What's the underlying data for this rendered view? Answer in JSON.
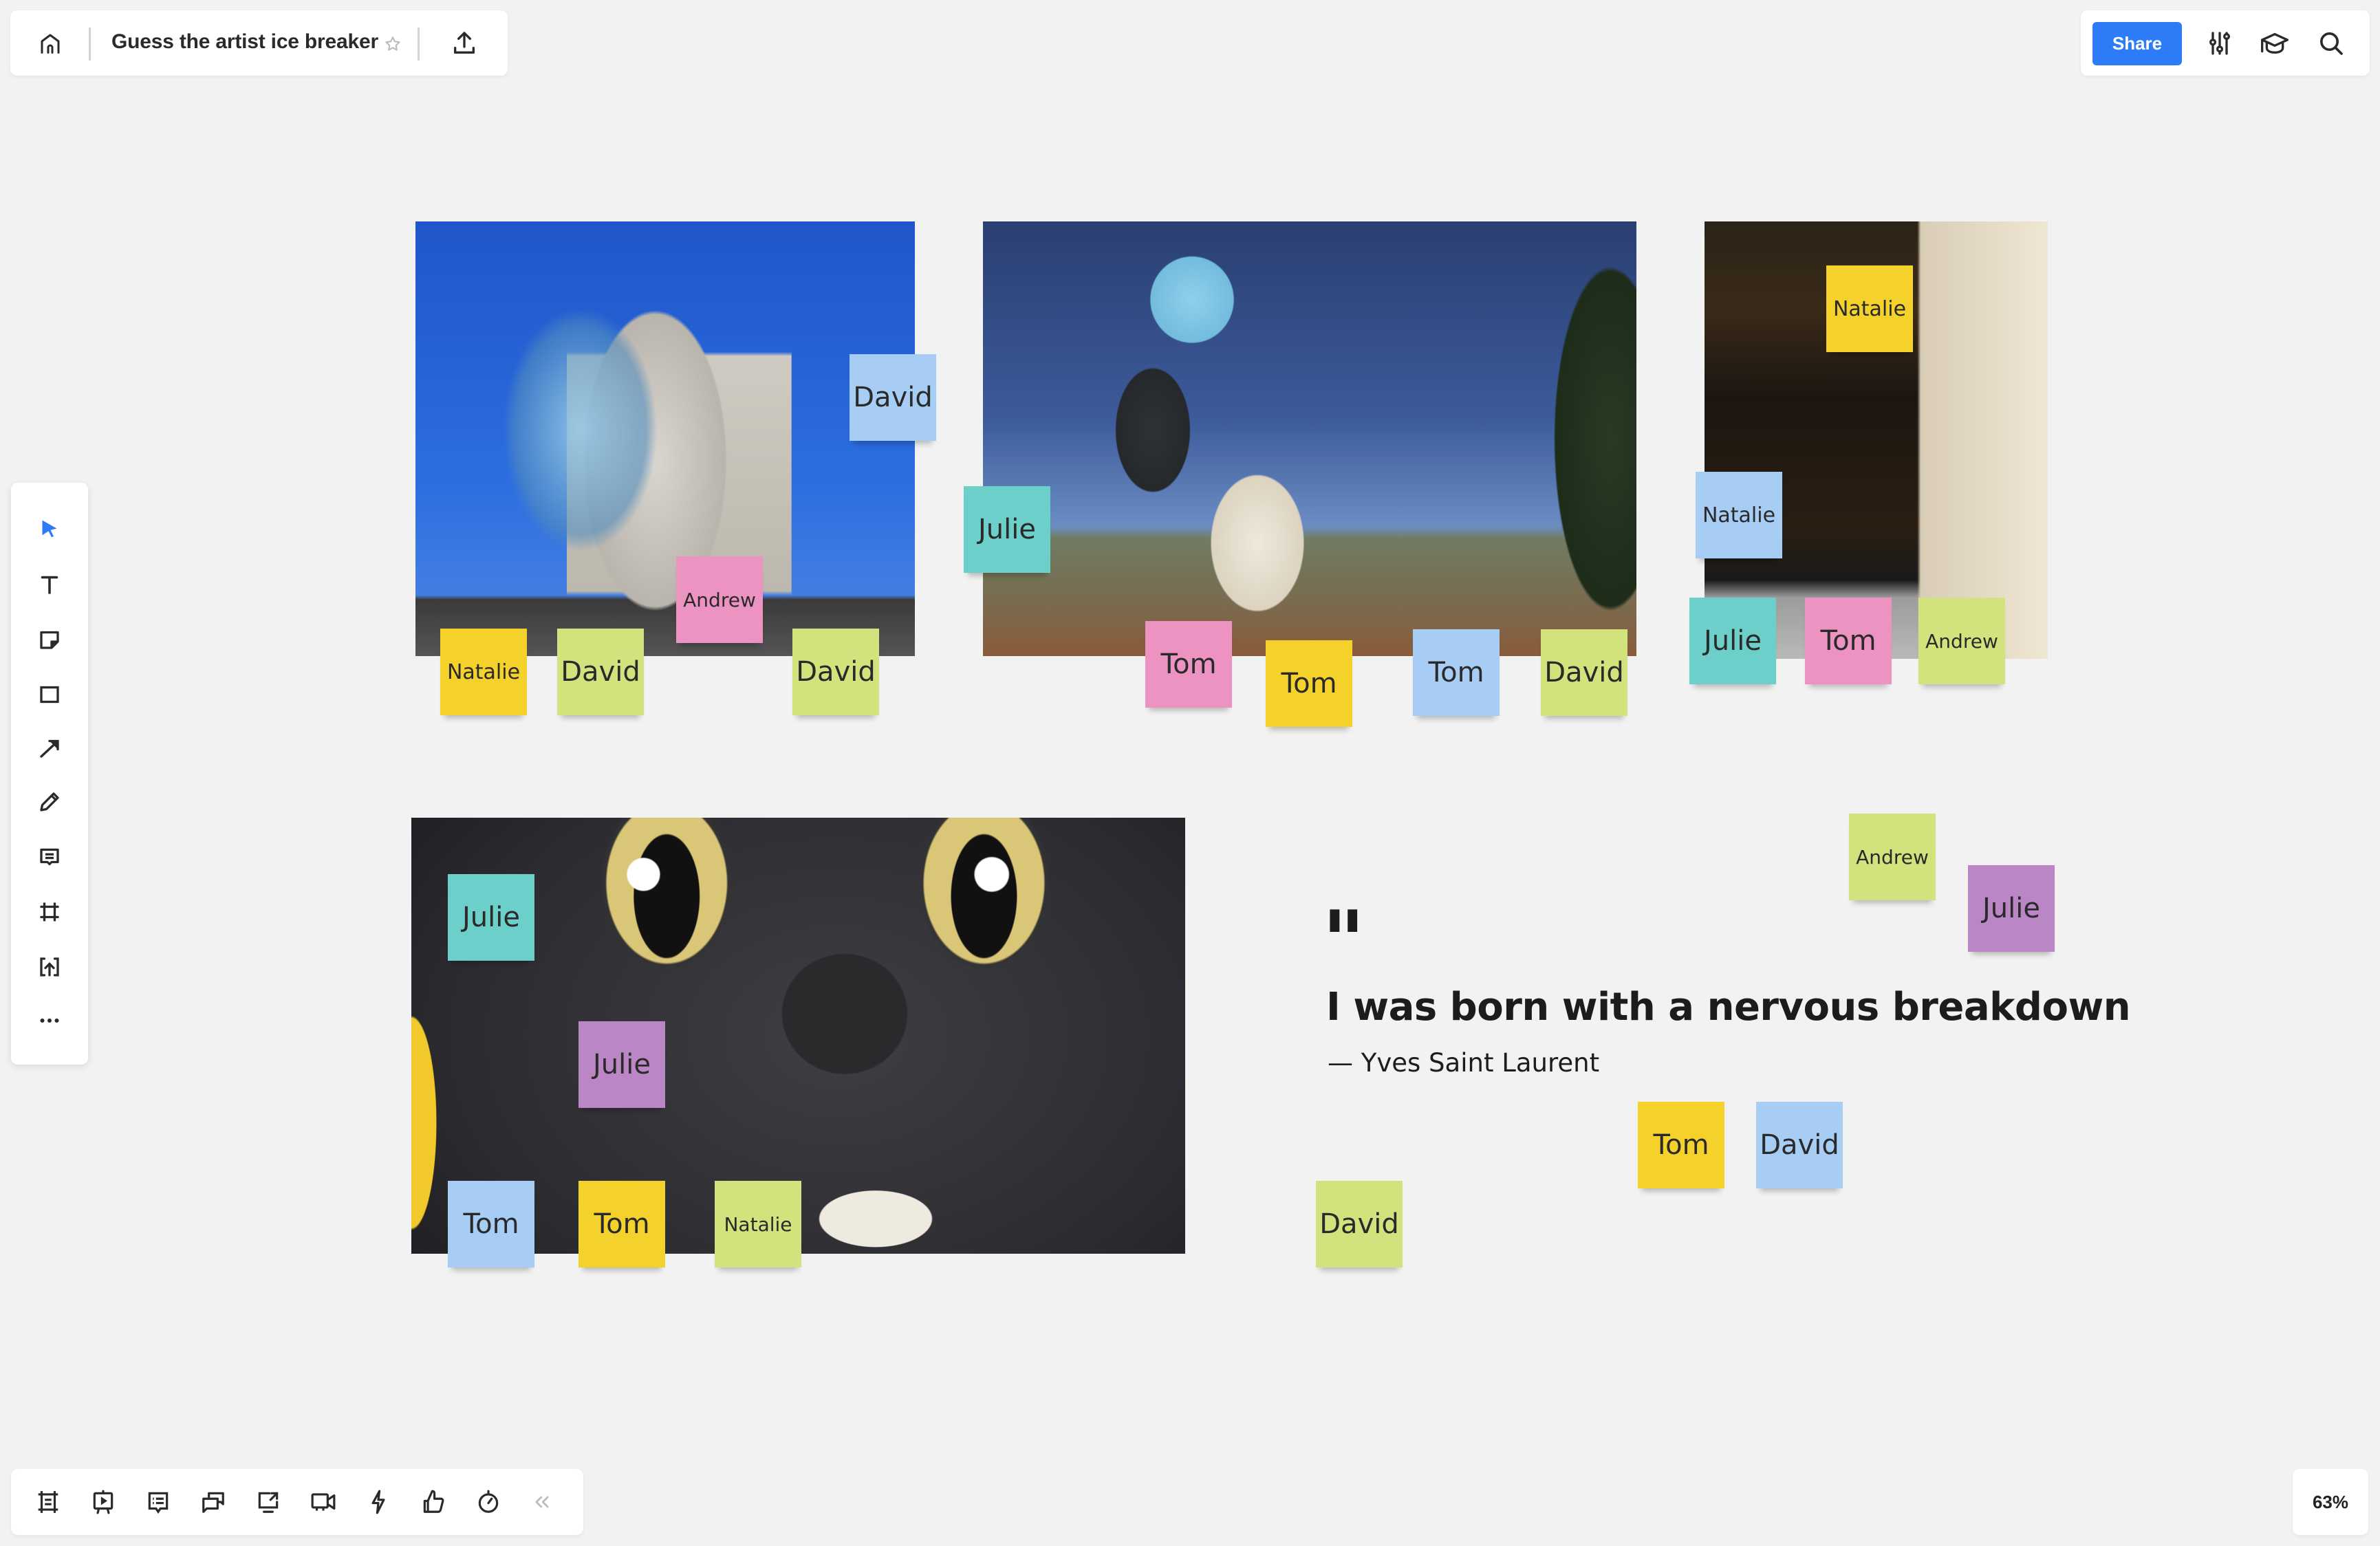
{
  "header": {
    "title": "Guess the artist ice breaker",
    "share_label": "Share",
    "icons": [
      "home-icon",
      "star-icon",
      "upload-icon",
      "settings-sliders-icon",
      "learning-cap-icon",
      "search-icon"
    ]
  },
  "left_toolbar": {
    "tools": [
      {
        "name": "select-tool",
        "icon": "cursor-arrow-icon",
        "active": true
      },
      {
        "name": "text-tool",
        "icon": "text-icon"
      },
      {
        "name": "sticky-note-tool",
        "icon": "sticky-note-icon"
      },
      {
        "name": "shape-tool",
        "icon": "rectangle-icon"
      },
      {
        "name": "connection-line-tool",
        "icon": "arrow-icon"
      },
      {
        "name": "pen-tool",
        "icon": "pen-icon"
      },
      {
        "name": "comment-tool",
        "icon": "comment-icon"
      },
      {
        "name": "frame-tool",
        "icon": "frame-icon"
      },
      {
        "name": "upload-tool",
        "icon": "upload-icon"
      },
      {
        "name": "more-tools",
        "icon": "more-dots-icon"
      }
    ],
    "accent": "#2d7bf6"
  },
  "bottom_toolbar": {
    "tools": [
      "frames-icon",
      "presentation-icon",
      "comments-list-icon",
      "chat-icon",
      "screen-share-icon",
      "video-icon",
      "lightning-icon",
      "thumbs-up-icon",
      "timer-icon",
      "collapse-chevrons-icon"
    ]
  },
  "zoom": {
    "level": "63%"
  },
  "canvas": {
    "images": [
      {
        "name": "dancing-house-photo",
        "description": "Dancing House building, Prague"
      },
      {
        "name": "runner-with-dog-photo",
        "description": "Woman running with a white dog"
      },
      {
        "name": "pub-storefront-photo",
        "description": "London pub front with Classic British Pies signs"
      },
      {
        "name": "black-cat-mascot-photo",
        "description": "Close-up of black cat mascot face"
      }
    ],
    "quote": {
      "mark": "\"",
      "text": "I was born with a nervous breakdown",
      "author": "— Yves Saint Laurent"
    },
    "note_colors": {
      "yellow": "#f5d12c",
      "green": "#d2e27c",
      "blue": "#a7cdf5",
      "pink": "#ec93c2",
      "teal": "#6ccfc9",
      "purple": "#bb86c6"
    },
    "sticky_notes": [
      {
        "text": "David",
        "color": "blue",
        "group": "dancing-house"
      },
      {
        "text": "Andrew",
        "color": "pink",
        "group": "dancing-house"
      },
      {
        "text": "Natalie",
        "color": "yellow",
        "group": "dancing-house"
      },
      {
        "text": "David",
        "color": "green",
        "group": "dancing-house"
      },
      {
        "text": "David",
        "color": "green",
        "group": "dancing-house"
      },
      {
        "text": "Julie",
        "color": "teal",
        "group": "runner-dog"
      },
      {
        "text": "Tom",
        "color": "pink",
        "group": "runner-dog"
      },
      {
        "text": "Tom",
        "color": "yellow",
        "group": "runner-dog"
      },
      {
        "text": "Tom",
        "color": "blue",
        "group": "runner-dog"
      },
      {
        "text": "David",
        "color": "green",
        "group": "runner-dog"
      },
      {
        "text": "Natalie",
        "color": "yellow",
        "group": "pub"
      },
      {
        "text": "Natalie",
        "color": "blue",
        "group": "pub"
      },
      {
        "text": "Julie",
        "color": "teal",
        "group": "pub"
      },
      {
        "text": "Tom",
        "color": "pink",
        "group": "pub"
      },
      {
        "text": "Andrew",
        "color": "green",
        "group": "pub"
      },
      {
        "text": "Julie",
        "color": "teal",
        "group": "black-cat"
      },
      {
        "text": "Julie",
        "color": "purple",
        "group": "black-cat"
      },
      {
        "text": "Tom",
        "color": "blue",
        "group": "black-cat"
      },
      {
        "text": "Tom",
        "color": "yellow",
        "group": "black-cat"
      },
      {
        "text": "Natalie",
        "color": "green",
        "group": "black-cat"
      },
      {
        "text": "Andrew",
        "color": "green",
        "group": "quote"
      },
      {
        "text": "Julie",
        "color": "purple",
        "group": "quote"
      },
      {
        "text": "Tom",
        "color": "yellow",
        "group": "quote"
      },
      {
        "text": "David",
        "color": "blue",
        "group": "quote"
      },
      {
        "text": "David",
        "color": "green",
        "group": "quote"
      }
    ]
  }
}
